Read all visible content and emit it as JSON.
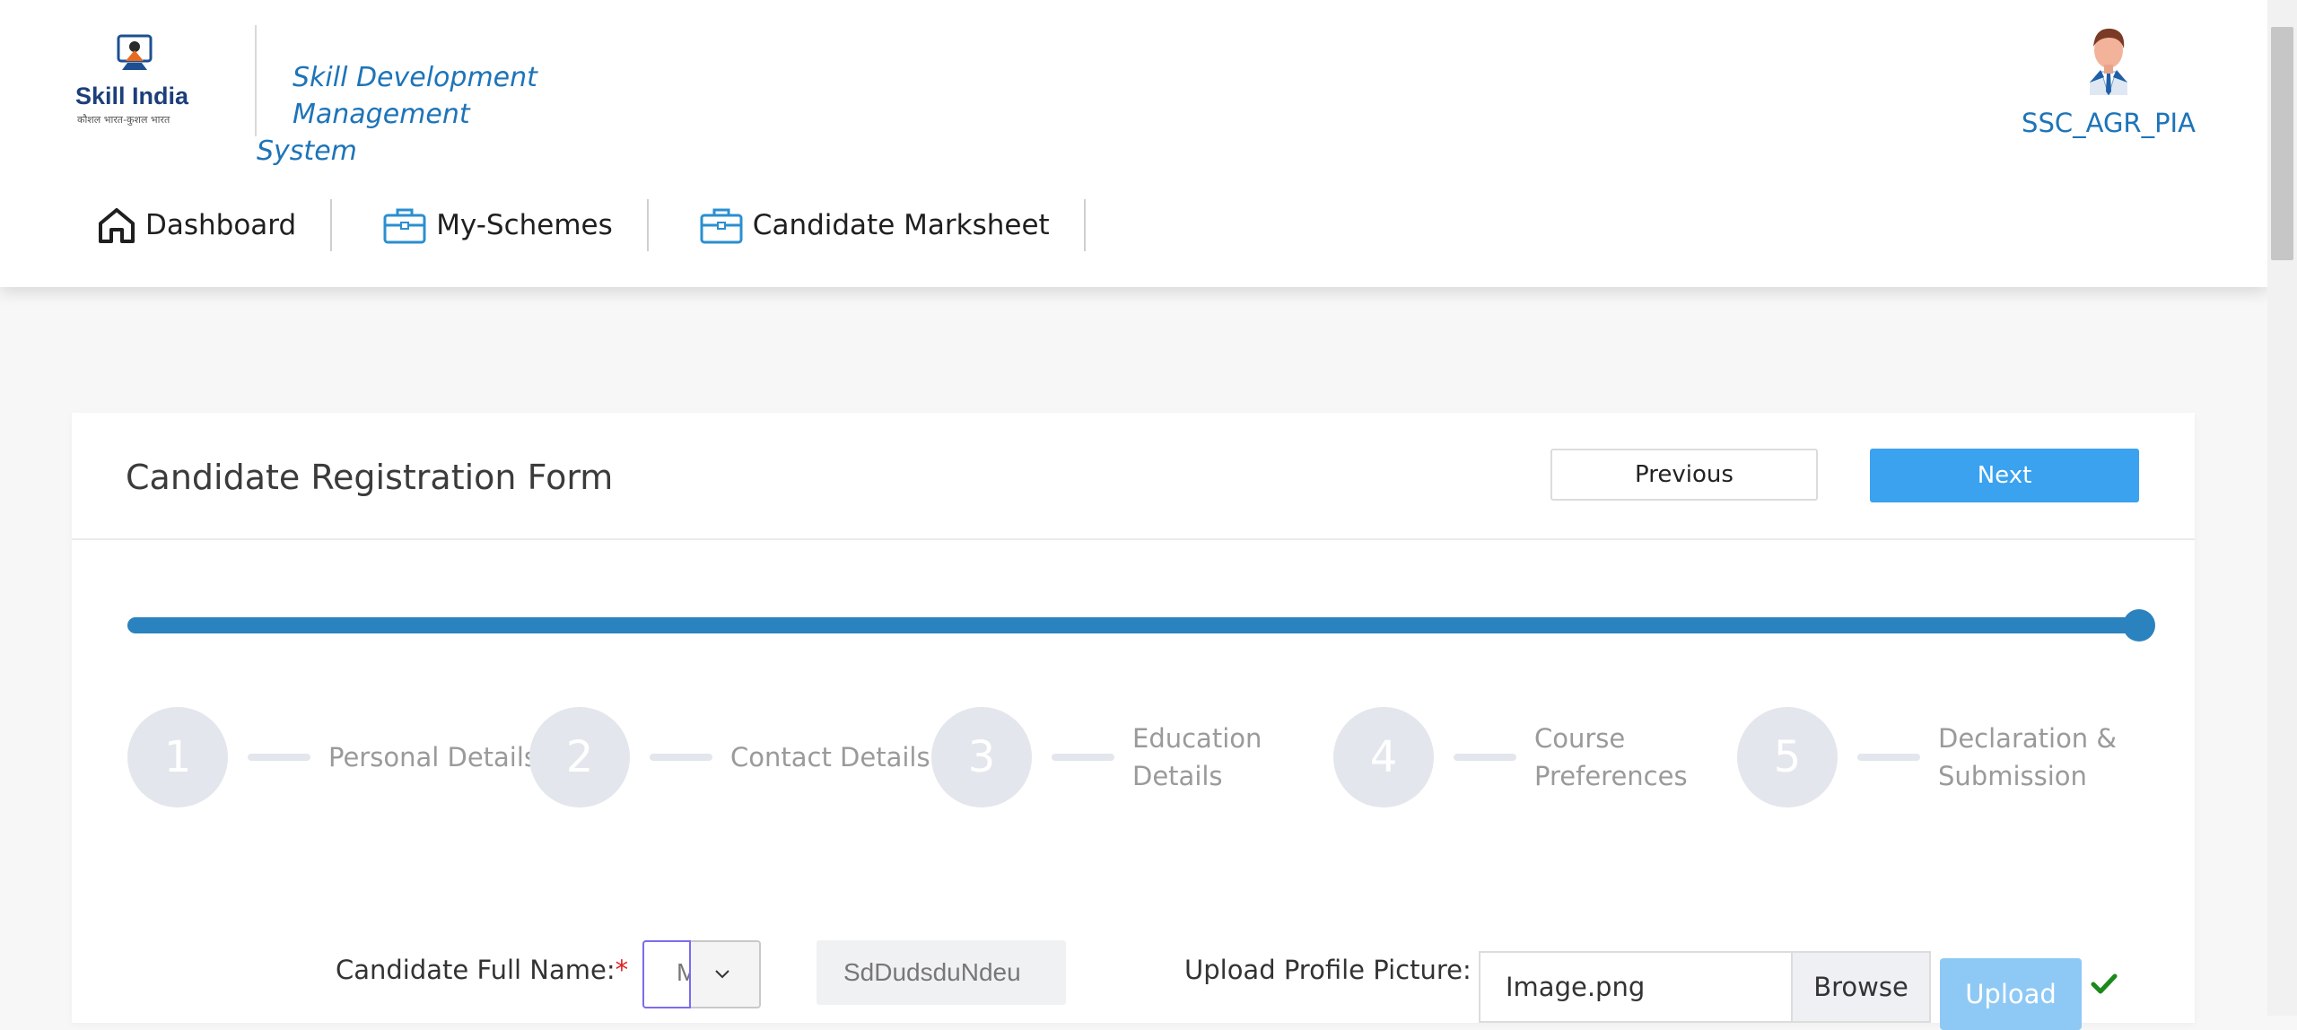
{
  "header": {
    "logo_text": "Skill India",
    "logo_tagline": "कौशल भारत-कुशल भारत",
    "system_title_line1": "Skill Development Management",
    "system_title_line2": "System",
    "username": "SSC_AGR_PIA"
  },
  "nav": {
    "items": [
      {
        "label": "Dashboard",
        "icon": "home-icon"
      },
      {
        "label": "My-Schemes",
        "icon": "briefcase-icon"
      },
      {
        "label": "Candidate Marksheet",
        "icon": "briefcase-icon"
      }
    ]
  },
  "form": {
    "title": "Candidate Registration Form",
    "previous_label": "Previous",
    "next_label": "Next",
    "progress_percent": 100,
    "steps": [
      {
        "number": "1",
        "label": "Personal Details"
      },
      {
        "number": "2",
        "label": "Contact Details"
      },
      {
        "number": "3",
        "label": "Education Details"
      },
      {
        "number": "4",
        "label": "Course Preferences"
      },
      {
        "number": "5",
        "label": "Declaration & Submission"
      }
    ],
    "fields": {
      "full_name_label": "Candidate Full Name:",
      "required_mark": "*",
      "salutation_value": "M",
      "name_value": "SdDudsduNdeu",
      "upload_label": "Upload Profile Picture:",
      "file_name": "Image.png",
      "browse_label": "Browse",
      "upload_label_btn": "Upload"
    }
  },
  "colors": {
    "brand_blue": "#1d74b8",
    "next_button": "#3aa2ef",
    "progress": "#2a82bf",
    "step_inactive": "#e3e6ec",
    "success": "#1a8a1a"
  }
}
